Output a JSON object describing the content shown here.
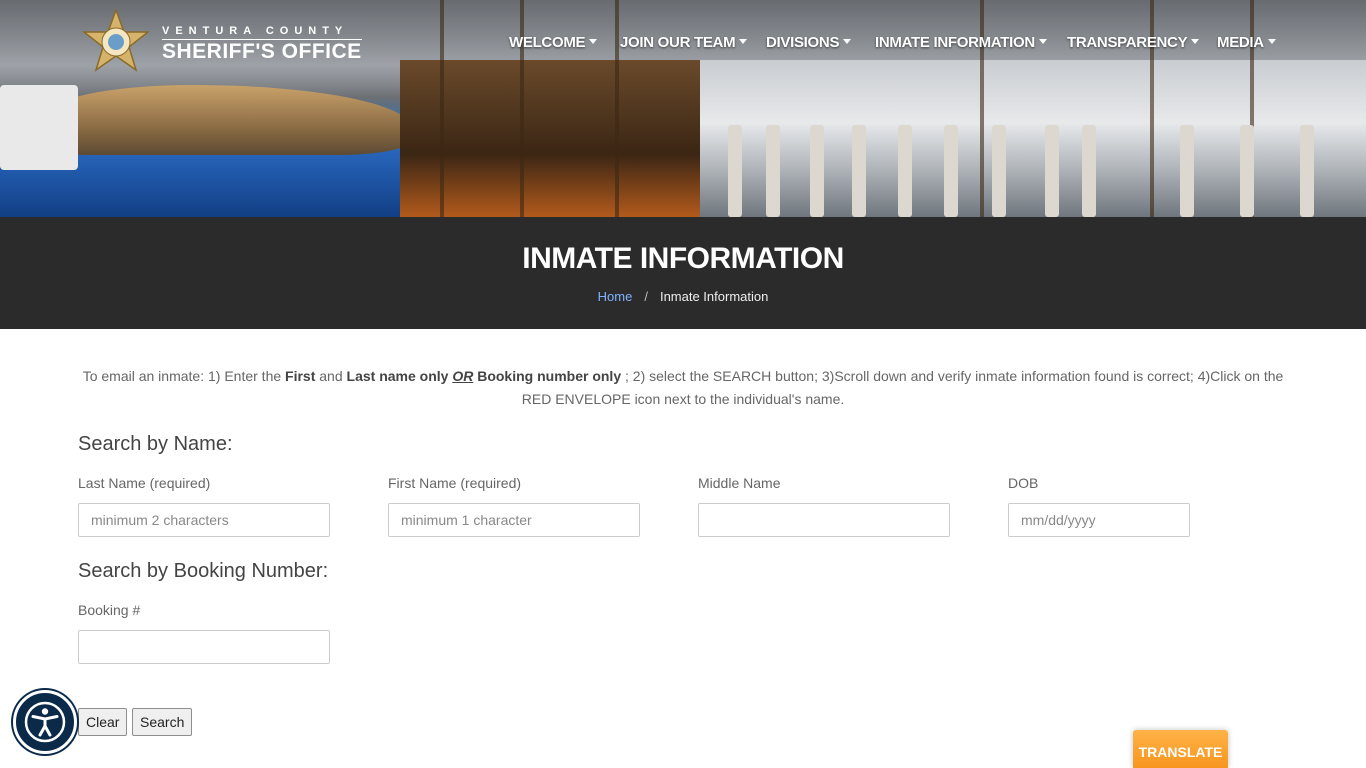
{
  "header": {
    "logo_top": "VENTURA COUNTY",
    "logo_main": "SHERIFF'S OFFICE",
    "nav": [
      {
        "label": "WELCOME"
      },
      {
        "label": "JOIN OUR TEAM"
      },
      {
        "label": "DIVISIONS"
      },
      {
        "label": "INMATE INFORMATION"
      },
      {
        "label": "TRANSPARENCY"
      },
      {
        "label": "MEDIA"
      }
    ]
  },
  "title_band": {
    "title": "INMATE INFORMATION",
    "breadcrumb_home": "Home",
    "breadcrumb_sep": "/",
    "breadcrumb_current": "Inmate Information"
  },
  "instructions": {
    "part1": "To email an inmate: 1) Enter the ",
    "first": "First",
    "and": " and ",
    "last": "Last name only",
    "or": "OR",
    "booking": "Booking number only",
    "part2": " ; 2) select the SEARCH button;  3)Scroll down and verify inmate information found is correct; 4)Click on the RED ENVELOPE icon next to the individual's name."
  },
  "search_name": {
    "heading": "Search by Name:",
    "last_label": "Last Name (required)",
    "last_placeholder": "minimum 2 characters",
    "first_label": "First Name (required)",
    "first_placeholder": "minimum 1 character",
    "middle_label": "Middle Name",
    "dob_label": "DOB",
    "dob_placeholder": "mm/dd/yyyy"
  },
  "search_booking": {
    "heading": "Search by Booking Number:",
    "booking_label": "Booking #"
  },
  "buttons": {
    "clear": "Clear",
    "search": "Search"
  },
  "widgets": {
    "translate": "TRANSLATE",
    "accessibility_icon": "accessibility-icon"
  }
}
